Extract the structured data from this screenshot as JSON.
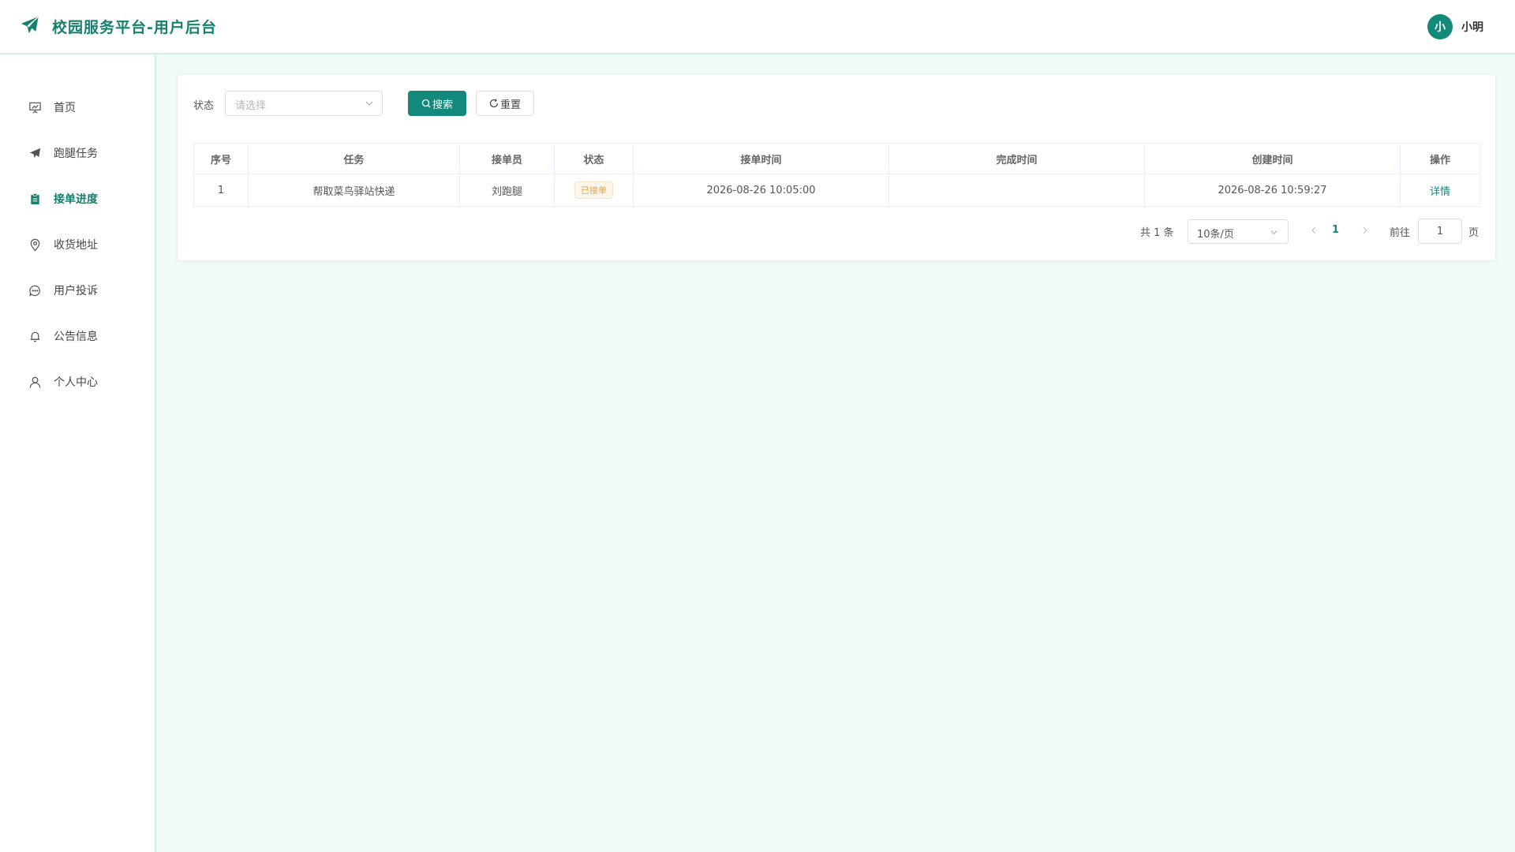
{
  "app": {
    "title": "校园服务平台-用户后台",
    "brand_color": "#16806f",
    "accent_color": "#12897a"
  },
  "user": {
    "avatar_char": "小",
    "name": "小明"
  },
  "sidebar": {
    "items": [
      {
        "label": "首页",
        "icon": "presentation-board-icon",
        "active": false
      },
      {
        "label": "跑腿任务",
        "icon": "paper-plane-icon",
        "active": false
      },
      {
        "label": "接单进度",
        "icon": "clipboard-icon",
        "active": true
      },
      {
        "label": "收货地址",
        "icon": "location-pin-icon",
        "active": false
      },
      {
        "label": "用户投诉",
        "icon": "chat-bubble-icon",
        "active": false
      },
      {
        "label": "公告信息",
        "icon": "bell-icon",
        "active": false
      },
      {
        "label": "个人中心",
        "icon": "user-icon",
        "active": false
      }
    ]
  },
  "filter": {
    "status_label": "状态",
    "status_placeholder": "请选择",
    "search_label": "搜索",
    "reset_label": "重置"
  },
  "table": {
    "columns": [
      "序号",
      "任务",
      "接单员",
      "状态",
      "接单时间",
      "完成时间",
      "创建时间",
      "操作"
    ],
    "rows": [
      {
        "index": "1",
        "task": "帮取菜鸟驿站快递",
        "courier": "刘跑腿",
        "status": "已接单",
        "accept_time": "2026-08-26 10:05:00",
        "finish_time": "",
        "create_time": "2026-08-26 10:59:27",
        "action": "详情"
      }
    ]
  },
  "pagination": {
    "total_text": "共 1 条",
    "page_size": "10条/页",
    "current_page": "1",
    "goto_label": "前往",
    "goto_value": "1",
    "page_suffix": "页"
  }
}
